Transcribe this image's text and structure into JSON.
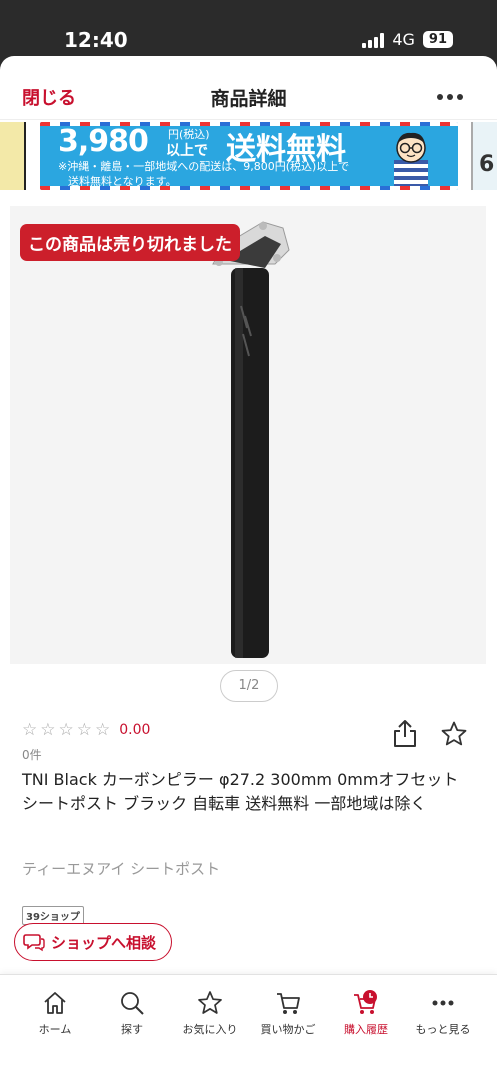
{
  "status": {
    "time": "12:40",
    "network": "4G",
    "battery": "91"
  },
  "nav": {
    "close_label": "閉じる",
    "title": "商品詳細"
  },
  "banner": {
    "price": "3,980",
    "price_tax": "円(税込)",
    "price_above": "以上で",
    "free_shipping": "送料無料",
    "note_line1": "※沖縄・離島・一部地域への配送は、9,800円(税込)以上で",
    "note_line2": "送料無料となります。",
    "right_stub_text": "6"
  },
  "gallery": {
    "soldout_label": "この商品は売り切れました",
    "pager": "1/2"
  },
  "product": {
    "rating": {
      "stars_filled": 0,
      "stars_total": 5,
      "score": "0.00",
      "review_count": "0件"
    },
    "title": "TNI Black カーボンピラー φ27.2 300mm 0mmオフセット シートポスト ブラック 自転車 送料無料 一部地域は除く",
    "subtitle": "ティーエヌアイ シートポスト"
  },
  "shop": {
    "badge": "39ショップ",
    "consult_label": "ショップへ相談"
  },
  "tabbar": {
    "items": [
      {
        "label": "ホーム",
        "icon": "home-icon"
      },
      {
        "label": "探す",
        "icon": "search-icon"
      },
      {
        "label": "お気に入り",
        "icon": "star-icon"
      },
      {
        "label": "買い物かご",
        "icon": "cart-icon"
      },
      {
        "label": "購入履歴",
        "icon": "purchase-history-icon",
        "active": true
      },
      {
        "label": "もっと見る",
        "icon": "more-icon"
      }
    ]
  },
  "colors": {
    "accent": "#c8102e",
    "soldout_bg": "#cc1f2b",
    "banner_blue": "#2ba6e0"
  }
}
